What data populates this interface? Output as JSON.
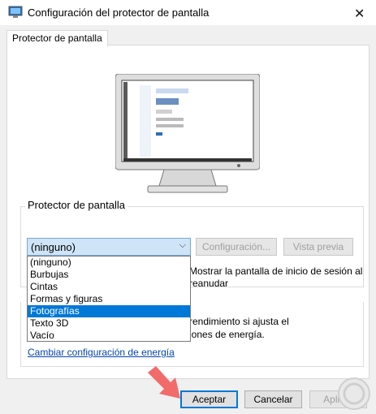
{
  "window": {
    "title": "Configuración del protector de pantalla"
  },
  "tabs": [
    {
      "label": "Protector de pantalla"
    }
  ],
  "screensaver_group": {
    "label": "Protector de pantalla"
  },
  "select": {
    "value": "(ninguno)",
    "options": [
      "(ninguno)",
      "Burbujas",
      "Cintas",
      "Formas y figuras",
      "Fotografías",
      "Texto 3D",
      "Vacío"
    ],
    "highlighted": "Fotografías"
  },
  "buttons": {
    "settings": "Configuración...",
    "preview": "Vista previa",
    "ok": "Aceptar",
    "cancel": "Cancelar",
    "apply": "Aplicar"
  },
  "resume_option": {
    "line1": "Mostrar la pantalla de inicio de sesión al",
    "line2": "reanudar"
  },
  "power": {
    "text_line1": "rendimiento si ajusta el",
    "text_line2": "iones de energía.",
    "link": "Cambiar configuración de energía"
  },
  "colors": {
    "accent": "#0078d7",
    "arrow": "#f26b6b",
    "link": "#0645ad"
  }
}
